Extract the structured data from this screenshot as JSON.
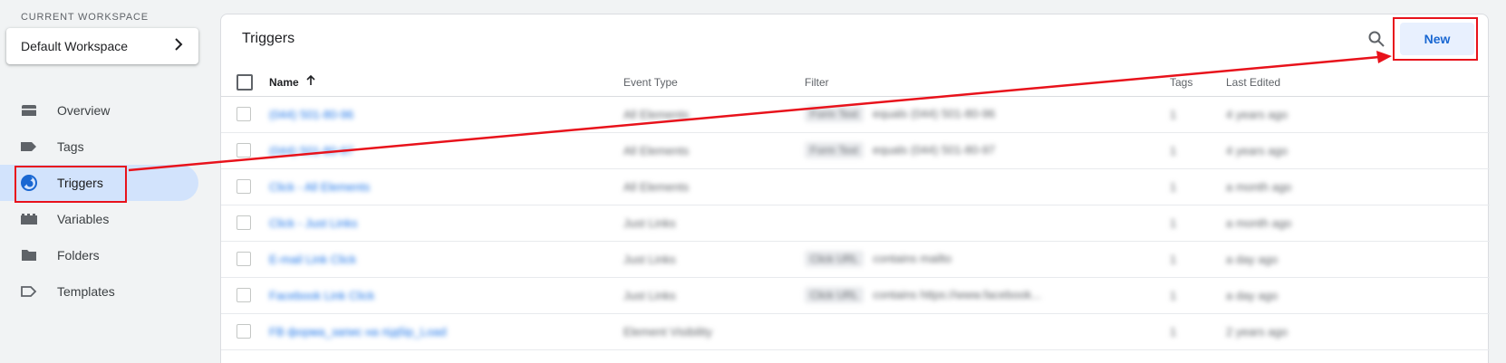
{
  "sidebar": {
    "workspace_label": "CURRENT WORKSPACE",
    "workspace_name": "Default Workspace",
    "items": [
      {
        "label": "Overview",
        "icon": "overview-icon"
      },
      {
        "label": "Tags",
        "icon": "tag-icon"
      },
      {
        "label": "Triggers",
        "icon": "trigger-icon",
        "active": true
      },
      {
        "label": "Variables",
        "icon": "variables-icon"
      },
      {
        "label": "Folders",
        "icon": "folder-icon"
      },
      {
        "label": "Templates",
        "icon": "template-icon"
      }
    ]
  },
  "main": {
    "title": "Triggers",
    "new_label": "New",
    "columns": {
      "name": "Name",
      "event_type": "Event Type",
      "filter": "Filter",
      "tags": "Tags",
      "last_edited": "Last Edited"
    },
    "rows": [
      {
        "name": "(044) 501-80-96",
        "event_type": "All Elements",
        "filter_chip": "Form Text",
        "filter_text": "equals (044) 501-80-96",
        "tags": "1",
        "last_edited": "4 years ago"
      },
      {
        "name": "(044) 501-80-97",
        "event_type": "All Elements",
        "filter_chip": "Form Text",
        "filter_text": "equals (044) 501-80-97",
        "tags": "1",
        "last_edited": "4 years ago"
      },
      {
        "name": "Click - All Elements",
        "event_type": "All Elements",
        "filter_chip": "",
        "filter_text": "",
        "tags": "1",
        "last_edited": "a month ago"
      },
      {
        "name": "Click - Just Links",
        "event_type": "Just Links",
        "filter_chip": "",
        "filter_text": "",
        "tags": "1",
        "last_edited": "a month ago"
      },
      {
        "name": "E-mail Link Click",
        "event_type": "Just Links",
        "filter_chip": "Click URL",
        "filter_text": "contains mailto",
        "tags": "1",
        "last_edited": "a day ago"
      },
      {
        "name": "Facebook Link Click",
        "event_type": "Just Links",
        "filter_chip": "Click URL",
        "filter_text": "contains https://www.facebook...",
        "tags": "1",
        "last_edited": "a day ago"
      },
      {
        "name": "FB форма_запис на підбір_Load",
        "event_type": "Element Visibility",
        "filter_chip": "",
        "filter_text": "",
        "tags": "1",
        "last_edited": "2 years ago"
      }
    ]
  },
  "annotation": {
    "color": "#e8121b"
  },
  "colors": {
    "accent": "#1a73e8",
    "active_nav_bg": "#d2e3fc",
    "new_button_bg": "#e8f0fe"
  }
}
